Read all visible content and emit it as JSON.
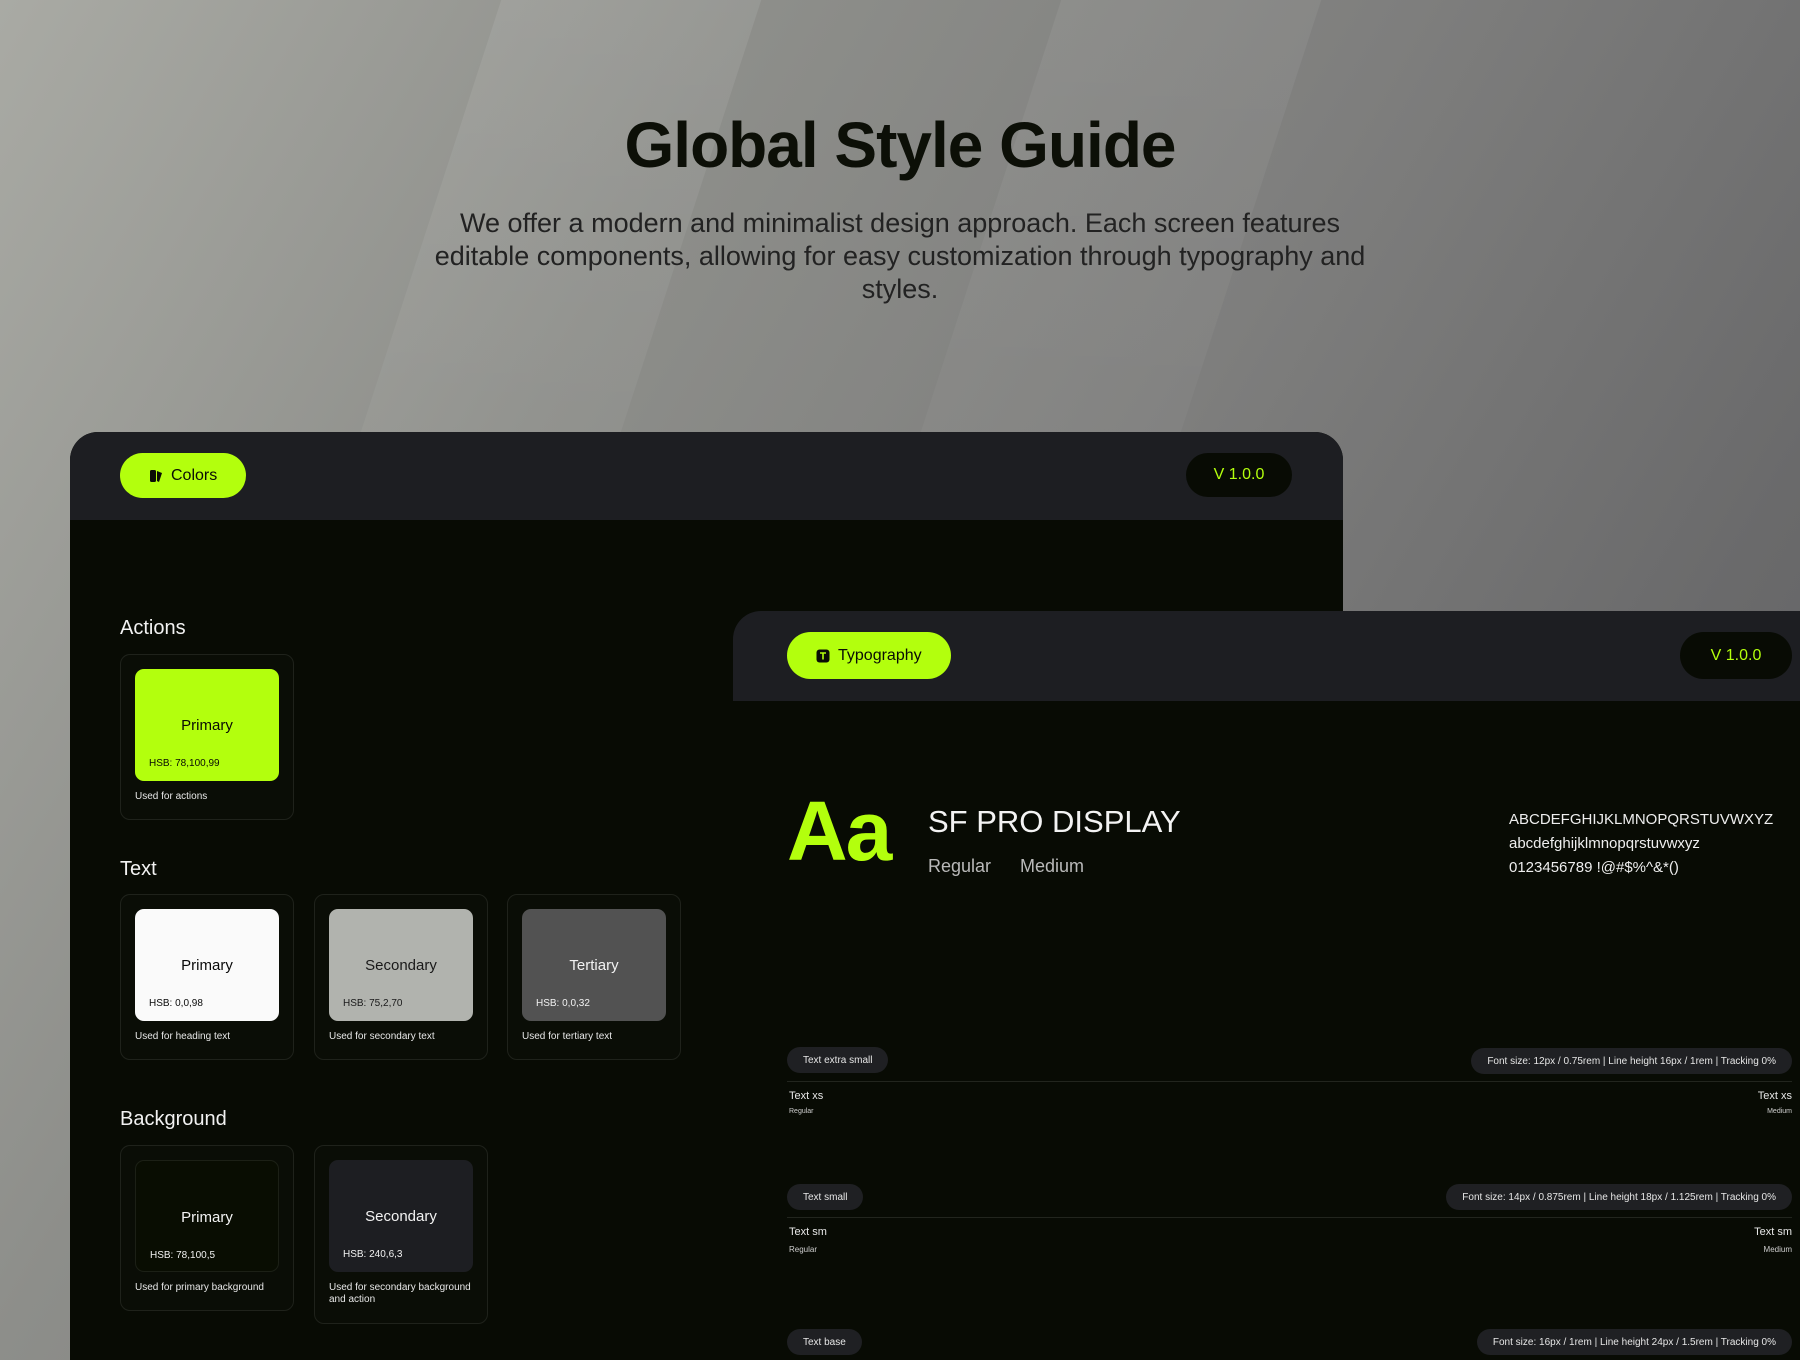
{
  "hero": {
    "title": "Global Style Guide",
    "subtitle": "We offer a modern and minimalist design approach. Each screen features editable components, allowing for easy customization through typography and styles."
  },
  "colors_panel": {
    "tab_label": "Colors",
    "tab_icon": "palette-icon",
    "version": "V 1.0.0",
    "sections": {
      "actions": {
        "title": "Actions",
        "cards": [
          {
            "name": "Primary",
            "hsb": "HSB: 78,100,99",
            "desc": "Used for actions",
            "color": "#b3ff0d",
            "text_color": "#0a0d05"
          }
        ]
      },
      "text": {
        "title": "Text",
        "cards": [
          {
            "name": "Primary",
            "hsb": "HSB: 0,0,98",
            "desc": "Used for heading text",
            "color": "#fafafa",
            "text_color": "#0a0a0a"
          },
          {
            "name": "Secondary",
            "hsb": "HSB: 75,2,70",
            "desc": "Used for secondary text",
            "color": "#b1b3ae",
            "text_color": "#1a1a1a"
          },
          {
            "name": "Tertiary",
            "hsb": "HSB: 0,0,32",
            "desc": "Used for tertiary text",
            "color": "#525252",
            "text_color": "#f2f2f2"
          }
        ]
      },
      "background": {
        "title": "Background",
        "cards": [
          {
            "name": "Primary",
            "hsb": "HSB: 78,100,5",
            "desc": "Used for primary background",
            "color": "#090d02",
            "text_color": "#f2f2f2"
          },
          {
            "name": "Secondary",
            "hsb": "HSB: 240,6,3",
            "desc": "Used for secondary background and action",
            "color": "#1d1e22",
            "text_color": "#f2f2f2"
          }
        ]
      }
    }
  },
  "typography_panel": {
    "tab_label": "Typography",
    "tab_icon": "type-icon",
    "version": "V 1.0.0",
    "specimen": "Aa",
    "font_name": "SF PRO DISPLAY",
    "weights": [
      "Regular",
      "Medium"
    ],
    "charset": [
      "ABCDEFGHIJKLMNOPQRSTUVWXYZ",
      "abcdefghijklmnopqrstuvwxyz",
      "0123456789 !@#$%^&*()"
    ],
    "styles": [
      {
        "chip": "Text extra small",
        "spec": "Font size: 12px / 0.75rem | Line height 16px / 1rem | Tracking 0%",
        "sample": "Text xs",
        "left_weight": "Regular",
        "right_weight": "Medium"
      },
      {
        "chip": "Text small",
        "spec": "Font size: 14px / 0.875rem | Line height 18px / 1.125rem | Tracking 0%",
        "sample": "Text sm",
        "left_weight": "Regular",
        "right_weight": "Medium"
      },
      {
        "chip": "Text base",
        "spec": "Font size: 16px / 1rem | Line height 24px / 1.5rem | Tracking 0%"
      }
    ]
  },
  "accent_color": "#b3ff0d"
}
